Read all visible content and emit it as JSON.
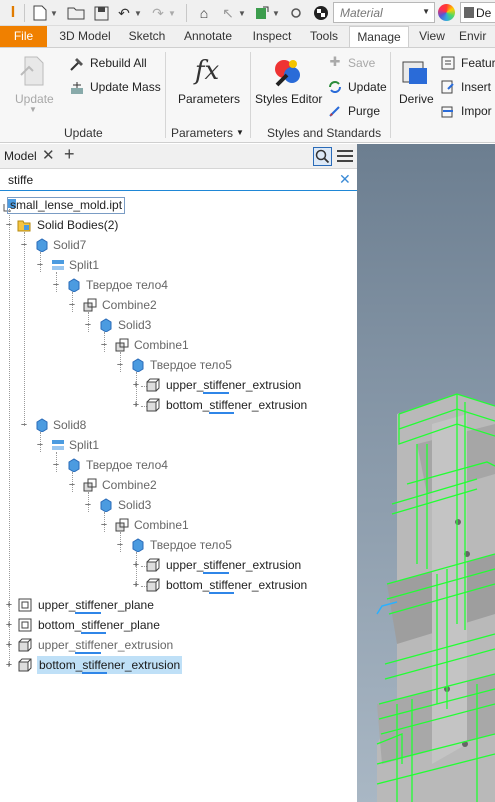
{
  "quick_access": {
    "material": "Material",
    "appearance": "De"
  },
  "tabs": [
    {
      "label": "File"
    },
    {
      "label": "3D Model"
    },
    {
      "label": "Sketch"
    },
    {
      "label": "Annotate"
    },
    {
      "label": "Inspect"
    },
    {
      "label": "Tools"
    },
    {
      "label": "Manage"
    },
    {
      "label": "View"
    },
    {
      "label": "Envir"
    }
  ],
  "ribbon": {
    "update": {
      "label": "Update",
      "rebuild_all": "Rebuild All",
      "update_mass": "Update Mass",
      "group": "Update"
    },
    "parameters": {
      "label": "Parameters",
      "group": "Parameters"
    },
    "styles": {
      "editor": "Styles Editor",
      "save": "Save",
      "update": "Update",
      "purge": "Purge",
      "group": "Styles and Standards"
    },
    "insert": {
      "derive": "Derive",
      "feature": "Featur",
      "insert": "Insert (",
      "import": "Impor"
    }
  },
  "browser": {
    "title": "Model",
    "filter": "stiffe",
    "rows": [
      {
        "pre": "small_lense_mold.ipt"
      },
      {
        "pre": "Solid Bodies(2)"
      },
      {
        "pre": "Solid7"
      },
      {
        "pre": "Split1"
      },
      {
        "pre": "Твердое тело4"
      },
      {
        "pre": "Combine2"
      },
      {
        "pre": "Solid3"
      },
      {
        "pre": "Combine1"
      },
      {
        "pre": "Твердое тело5"
      },
      {
        "pre": "upper_",
        "hl": "stiffe",
        "post": "ner_extrusion"
      },
      {
        "pre": "bottom_",
        "hl": "stiffe",
        "post": "ner_extrusion"
      },
      {
        "pre": "Solid8"
      },
      {
        "pre": "Split1"
      },
      {
        "pre": "Твердое тело4"
      },
      {
        "pre": "Combine2"
      },
      {
        "pre": "Solid3"
      },
      {
        "pre": "Combine1"
      },
      {
        "pre": "Твердое тело5"
      },
      {
        "pre": "upper_",
        "hl": "stiffe",
        "post": "ner_extrusion"
      },
      {
        "pre": "bottom_",
        "hl": "stiffe",
        "post": "ner_extrusion"
      },
      {
        "pre": "upper_",
        "hl": "stiffe",
        "post": "ner_plane"
      },
      {
        "pre": "bottom_",
        "hl": "stiffe",
        "post": "ner_plane"
      },
      {
        "pre": "upper_",
        "hl": "stiffe",
        "post": "ner_extrusion"
      },
      {
        "pre": "bottom_",
        "hl": "stiffe",
        "post": "ner_extrusion"
      }
    ]
  },
  "colors": {
    "file_tab": "#f08000",
    "selection": "#bfe0f7",
    "match_underline": "#2f86e8",
    "wireframe": "#22ff33"
  }
}
